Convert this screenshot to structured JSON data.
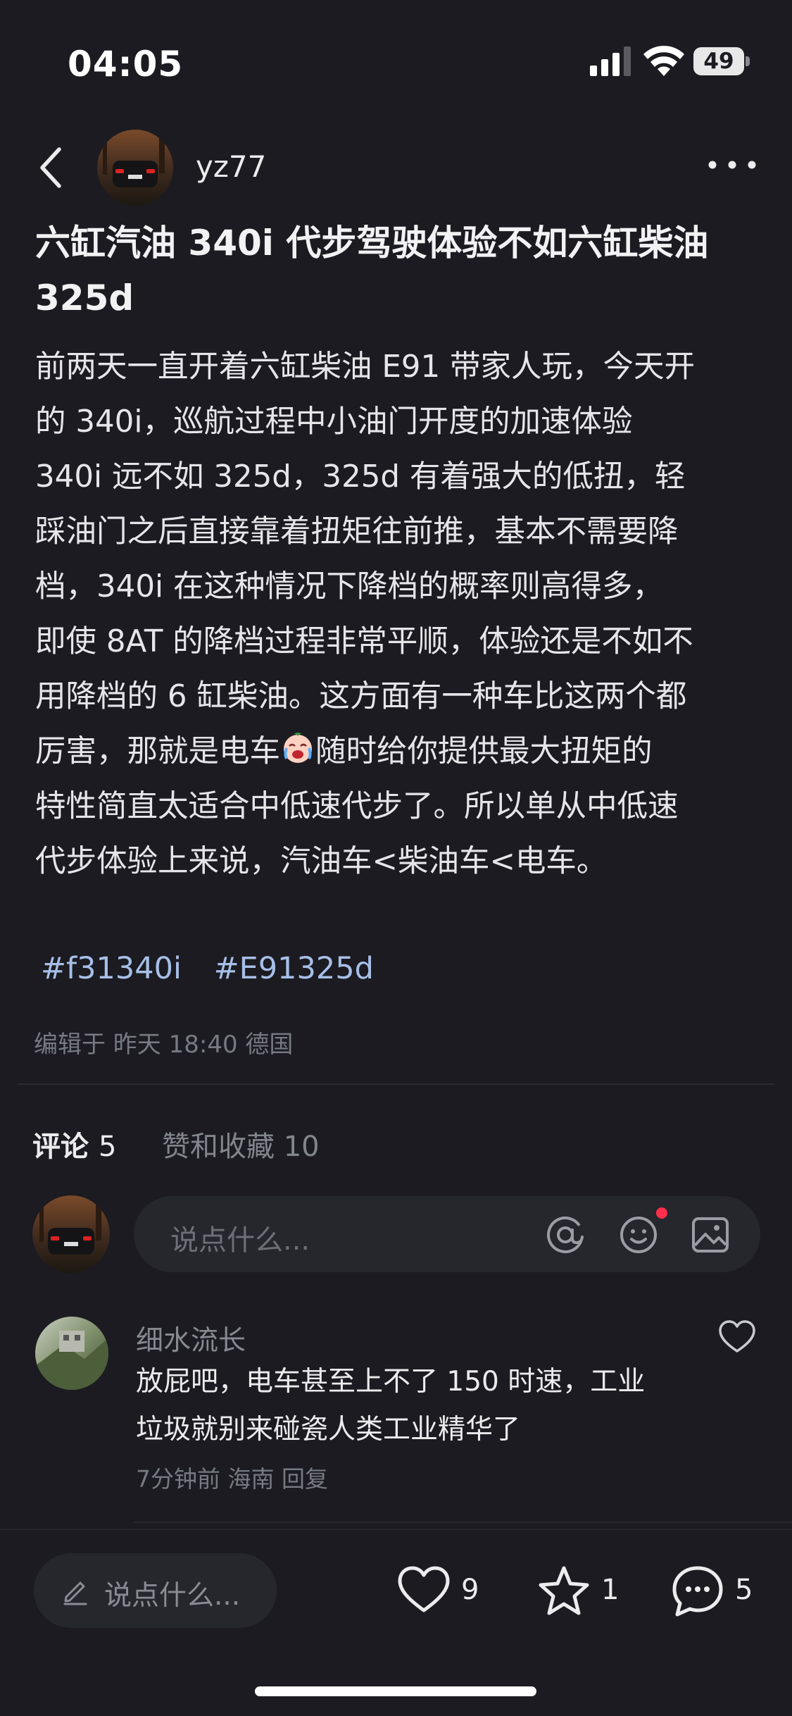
{
  "status_bar": {
    "time": "04:05",
    "battery": "49"
  },
  "header": {
    "author": "yz77"
  },
  "post": {
    "title_lines": [
      "六缸汽油 340i 代步驾驶体验不如六缸柴油",
      "325d"
    ],
    "body_lines": [
      "前两天一直开着六缸柴油 E91 带家人玩，今天开",
      "的 340i，巡航过程中小油门开度的加速体验",
      " 340i 远不如 325d，325d 有着强大的低扭，轻",
      "踩油门之后直接靠着扭矩往前推，基本不需要降",
      "档，340i 在这种情况下降档的概率则高得多，",
      "即使 8AT 的降档过程非常平顺，体验还是不如不",
      "用降档的 6 缸柴油。这方面有一种车比这两个都",
      "厉害，那就是电车",
      "随时给你提供最大扭矩的",
      "特性简直太适合中低速代步了。所以单从中低速",
      "代步体验上来说，汽油车<柴油车<电车。"
    ],
    "hashtags": [
      "#f31340i",
      "#E91325d"
    ],
    "meta": "编辑于 昨天 18:40 德国"
  },
  "tabs": {
    "comments_label": "评论",
    "comments_count": "5",
    "likes_label": "赞和收藏 10"
  },
  "compose": {
    "placeholder": "说点什么..."
  },
  "comments": [
    {
      "author": "细水流长",
      "text_lines": [
        "放屁吧，电车甚至上不了 150 时速，工业",
        "垃圾就别来碰瓷人类工业精华了"
      ],
      "meta": "7分钟前  海南  回复"
    }
  ],
  "bottom_bar": {
    "compose_placeholder": "说点什么...",
    "like_count": "9",
    "star_count": "1",
    "comment_count": "5"
  },
  "icons": {
    "back": "chevron-left-icon",
    "more": "more-dots-icon",
    "at": "at-icon",
    "emoji": "smiley-icon",
    "image": "image-icon",
    "heart": "heart-icon",
    "star": "star-icon",
    "comment": "comment-bubble-icon",
    "pencil": "pencil-icon"
  },
  "colors": {
    "background": "#1b1b21",
    "hashtag": "#a7bfe8",
    "notification_dot": "#ff2e4d"
  }
}
